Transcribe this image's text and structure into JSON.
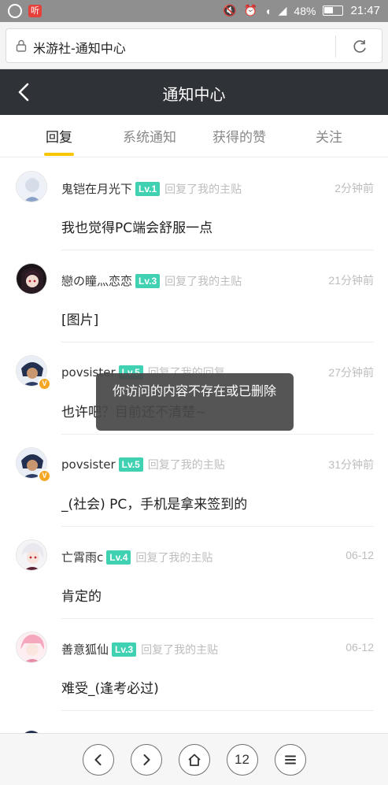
{
  "status_bar": {
    "battery": "48%",
    "time": "21:47",
    "app_badge": "听"
  },
  "browser": {
    "url_text": "米游社-通知中心"
  },
  "header": {
    "title": "通知中心"
  },
  "tabs": [
    {
      "label": "回复",
      "active": true
    },
    {
      "label": "系统通知",
      "active": false
    },
    {
      "label": "获得的赞",
      "active": false
    },
    {
      "label": "关注",
      "active": false
    }
  ],
  "notifications": [
    {
      "user": "鬼铠在月光下",
      "level": "Lv.1",
      "action": "回复了我的主贴",
      "time": "2分钟前",
      "content": "我也觉得PC端会舒服一点",
      "verified": false
    },
    {
      "user": "戀の瞳灬恋恋",
      "level": "Lv.3",
      "action": "回复了我的主贴",
      "time": "21分钟前",
      "content": "[图片]",
      "verified": false
    },
    {
      "user": "povsister",
      "level": "Lv.5",
      "action": "回复了我的回复",
      "time": "27分钟前",
      "content": "也许吧？目前还不清楚~",
      "verified": true
    },
    {
      "user": "povsister",
      "level": "Lv.5",
      "action": "回复了我的主贴",
      "time": "31分钟前",
      "content": "_(社会) PC，手机是拿来签到的",
      "verified": true
    },
    {
      "user": "亡霄雨c",
      "level": "Lv.4",
      "action": "回复了我的主贴",
      "time": "06-12",
      "content": "肯定的",
      "verified": false
    },
    {
      "user": "善意狐仙",
      "level": "Lv.3",
      "action": "回复了我的主贴",
      "time": "06-12",
      "content": "难受_(逢考必过)",
      "verified": false
    }
  ],
  "toast": {
    "message": "你访问的内容不存在或已删除"
  },
  "toolbar": {
    "tab_count": "12"
  },
  "colors": {
    "accent": "#f7c600",
    "level_badge": "#3fd1b2",
    "header_bg": "#2f3237"
  }
}
